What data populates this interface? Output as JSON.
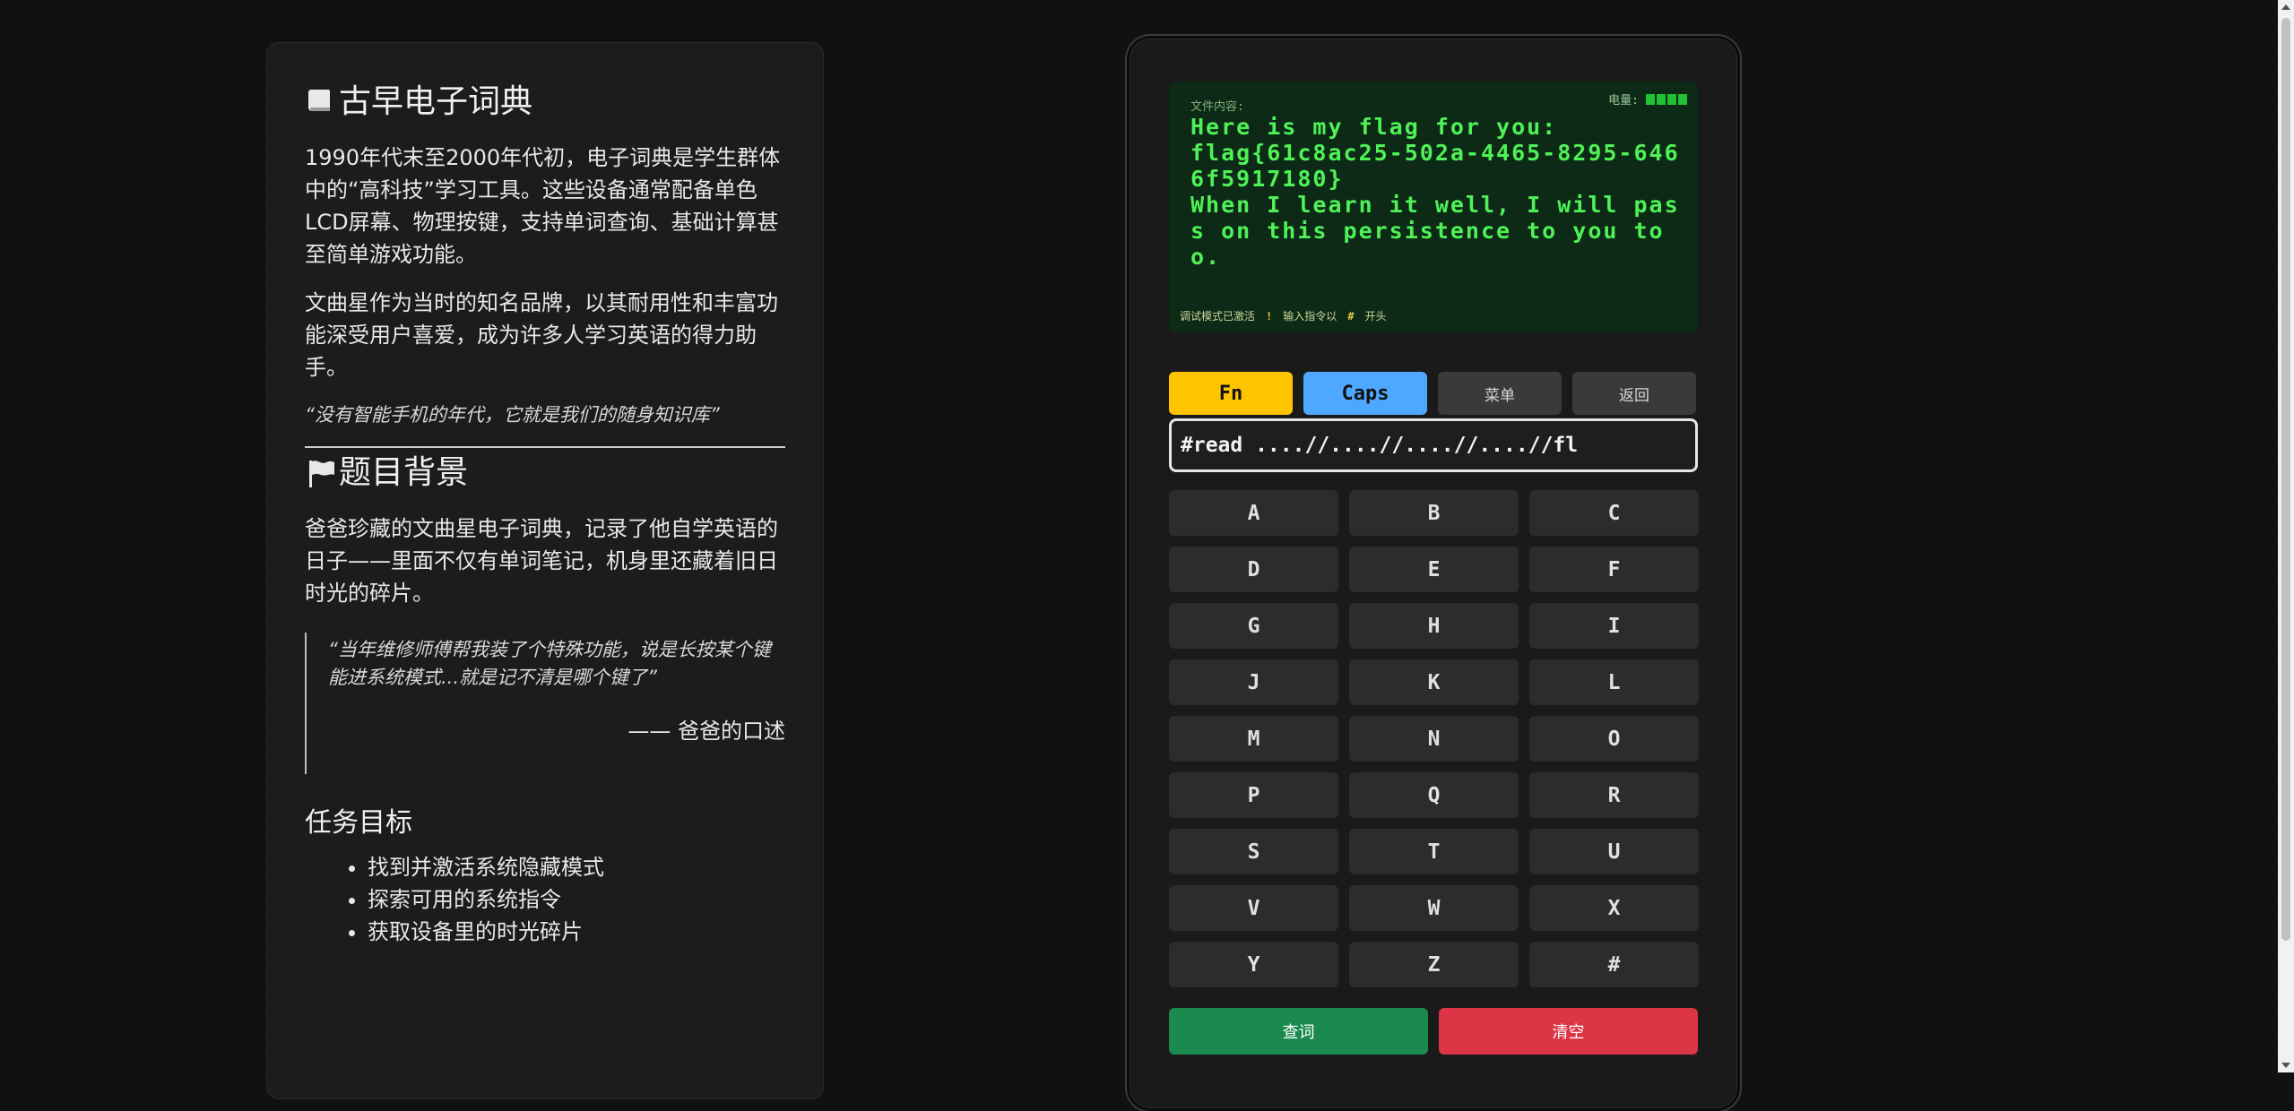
{
  "info": {
    "title": "古早电子词典",
    "para1": "1990年代末至2000年代初，电子词典是学生群体中的“高科技”学习工具。这些设备通常配备单色LCD屏幕、物理按键，支持单词查询、基础计算甚至简单游戏功能。",
    "para2": "文曲星作为当时的知名品牌，以其耐用性和丰富功能深受用户喜爱，成为许多人学习英语的得力助手。",
    "quote": "“没有智能手机的年代，它就是我们的随身知识库”",
    "background_title": "题目背景",
    "background_text": "爸爸珍藏的文曲星电子词典，记录了他自学英语的日子——里面不仅有单词笔记，机身里还藏着旧日时光的碎片。",
    "blockquote_text": "“当年维修师傅帮我装了个特殊功能，说是长按某个键能进系统模式...就是记不清是哪个键了”",
    "blockquote_cite": "—— 爸爸的口述",
    "task_title": "任务目标",
    "tasks": [
      "找到并激活系统隐藏模式",
      "探索可用的系统指令",
      "获取设备里的时光碎片"
    ]
  },
  "device": {
    "file_label": "文件内容:",
    "battery_label": "电量:",
    "battery_level": 4,
    "screen_text": "Here is my flag for you:\nflag{61c8ac25-502a-4465-8295-6466f5917180}\nWhen I learn it well, I will pass on this persistence to you too.",
    "status": {
      "debug": "调试模式已激活",
      "sep1": "!",
      "hint": "输入指令以",
      "sep2": "#",
      "start": "开头"
    },
    "fn_label": "Fn",
    "caps_label": "Caps",
    "menu_label": "菜单",
    "back_label": "返回",
    "command_value": "#read ....//....//....//....//fl",
    "keys": [
      "A",
      "B",
      "C",
      "D",
      "E",
      "F",
      "G",
      "H",
      "I",
      "J",
      "K",
      "L",
      "M",
      "N",
      "O",
      "P",
      "Q",
      "R",
      "S",
      "T",
      "U",
      "V",
      "W",
      "X",
      "Y",
      "Z",
      "#"
    ],
    "search_label": "查词",
    "clear_label": "清空"
  },
  "colors": {
    "screen_bg": "#0d2a16",
    "screen_text": "#4ef256",
    "fn": "#ffc400",
    "caps": "#4fa8ff",
    "search": "#1b8a4e",
    "clear": "#dc3545"
  },
  "icons": {
    "title_icon": "book-icon",
    "background_icon": "flag-icon"
  }
}
